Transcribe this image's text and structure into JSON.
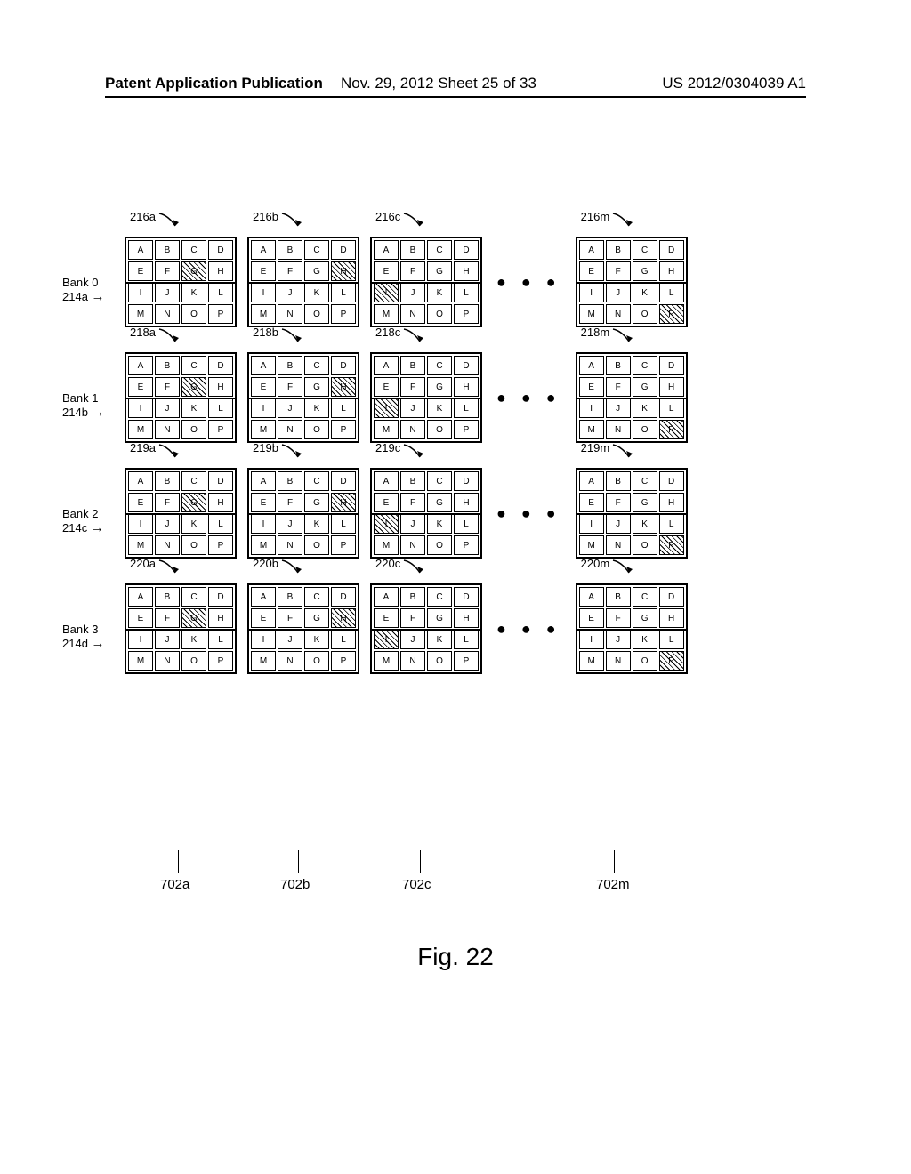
{
  "header": {
    "left": "Patent Application Publication",
    "mid": "Nov. 29, 2012  Sheet 25 of 33",
    "right": "US 2012/0304039 A1"
  },
  "figure_label": "Fig. 22",
  "cells": [
    "A",
    "B",
    "C",
    "D",
    "E",
    "F",
    "G",
    "H",
    "I",
    "J",
    "K",
    "L",
    "M",
    "N",
    "O",
    "P"
  ],
  "banks": [
    {
      "label_line1": "Bank 0",
      "label_line2": "214a",
      "grids": [
        "216a",
        "216b",
        "216c",
        "216m"
      ],
      "hatched": {
        "0": "G",
        "1": "H",
        "2": "I",
        "3": "P"
      }
    },
    {
      "label_line1": "Bank 1",
      "label_line2": "214b",
      "grids": [
        "218a",
        "218b",
        "218c",
        "218m"
      ],
      "hatched": {
        "0": "G",
        "1": "H",
        "2": "I",
        "3": "P"
      }
    },
    {
      "label_line1": "Bank 2",
      "label_line2": "214c",
      "grids": [
        "219a",
        "219b",
        "219c",
        "219m"
      ],
      "hatched": {
        "0": "G",
        "1": "H",
        "2": "I",
        "3": "P"
      }
    },
    {
      "label_line1": "Bank 3",
      "label_line2": "214d",
      "grids": [
        "220a",
        "220b",
        "220c",
        "220m"
      ],
      "hatched": {
        "0": "G",
        "1": "H",
        "2": "I",
        "3": "P"
      }
    }
  ],
  "columns": [
    "702a",
    "702b",
    "702c",
    "702m"
  ],
  "ellipsis": "● ● ●"
}
